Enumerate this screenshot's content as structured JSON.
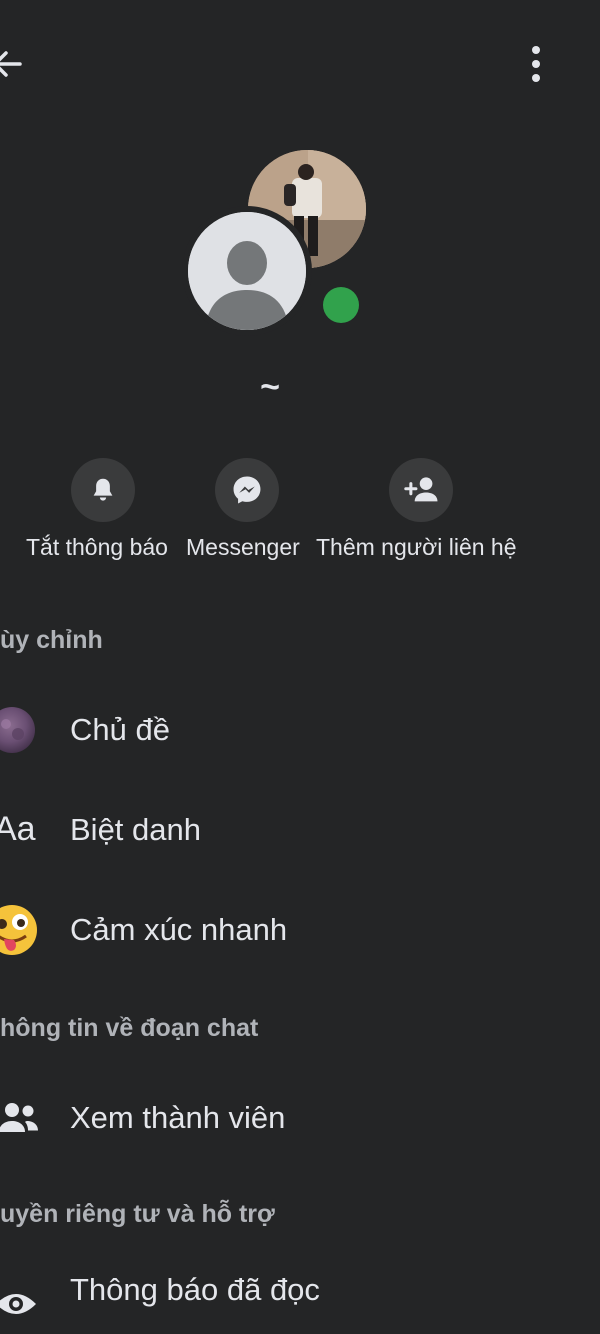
{
  "header": {
    "back_icon": "arrow-left-icon",
    "menu_icon": "more-vertical-icon"
  },
  "profile": {
    "name": "~",
    "status_color": "#31a24c"
  },
  "actions": [
    {
      "label": "Tắt thông báo",
      "icon": "bell-icon"
    },
    {
      "label": "Messenger",
      "icon": "messenger-icon"
    },
    {
      "label": "Thêm người liên hệ",
      "icon": "add-person-icon"
    }
  ],
  "sections": {
    "customize": {
      "title": "ùy chỉnh",
      "items": [
        {
          "label": "Chủ đề",
          "icon": "theme-icon"
        },
        {
          "label": "Biệt danh",
          "icon": "text-aa-icon",
          "icon_text": "Aa"
        },
        {
          "label": "Cảm xúc nhanh",
          "icon": "emoji-icon",
          "icon_text": "😜"
        }
      ]
    },
    "chat_info": {
      "title": "hông tin về đoạn chat",
      "items": [
        {
          "label": "Xem thành viên",
          "icon": "people-icon"
        }
      ]
    },
    "privacy": {
      "title": "uyền riêng tư và hỗ trợ",
      "items": [
        {
          "label": "Thông báo đã đọc",
          "icon": "eye-icon"
        }
      ]
    }
  },
  "colors": {
    "background": "#242526",
    "text": "#e4e6eb",
    "secondary_text": "#b0b3b8",
    "button_bg": "#3a3b3c"
  }
}
